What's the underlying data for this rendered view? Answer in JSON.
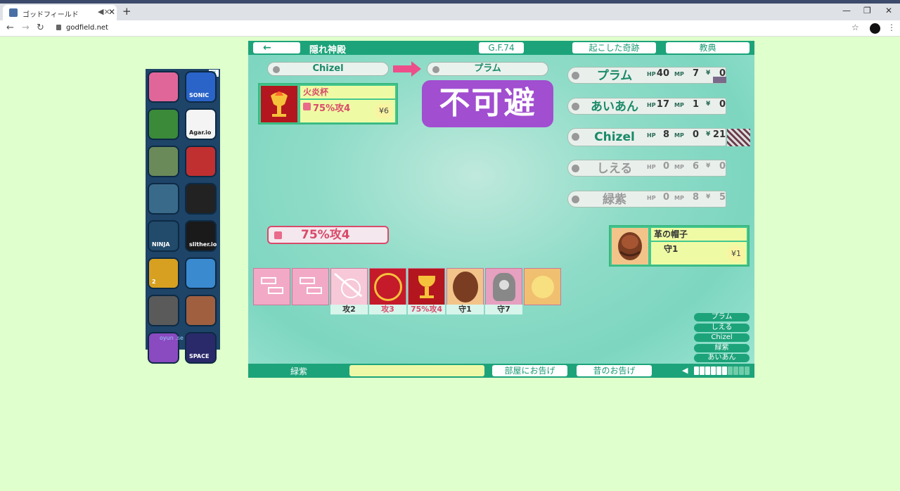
{
  "browser": {
    "tab_title": "ゴッドフィールド",
    "url": "godfield.net",
    "mute_icon": "speaker-mute-icon",
    "close_glyph": "✕",
    "newtab_glyph": "+",
    "min_glyph": "—",
    "max_glyph": "❐",
    "winclose_glyph": "✕"
  },
  "ad": {
    "apps": [
      "",
      "SONIC",
      "",
      "Agar.io",
      "",
      "",
      "",
      "",
      "NINJA",
      "slither.io",
      "2",
      "",
      "",
      "",
      "",
      "SPACE"
    ],
    "footer": "oyun .se",
    "badge": "i✕"
  },
  "game": {
    "back_glyph": "←",
    "stage_name": "隠れ神殿",
    "era": "G.F.74",
    "miracles_label": "起こした奇跡",
    "scripture_label": "教典",
    "attacker": "Chizel",
    "defender": "プラム",
    "active_card": {
      "name": "火炎杯",
      "effect": "75%攻4",
      "cost": "¥6"
    },
    "banner": "不可避",
    "effect_pill": "75%攻4",
    "players": [
      {
        "name": "プラム",
        "hp": "40",
        "mp": "7",
        "yen": "0",
        "alive": true
      },
      {
        "name": "あいあん",
        "hp": "17",
        "mp": "1",
        "yen": "0",
        "alive": true
      },
      {
        "name": "Chizel",
        "hp": "8",
        "mp": "0",
        "yen": "21",
        "alive": true
      },
      {
        "name": "しえる",
        "hp": "0",
        "mp": "6",
        "yen": "0",
        "alive": false
      },
      {
        "name": "緑紫",
        "hp": "0",
        "mp": "8",
        "yen": "5",
        "alive": false
      }
    ],
    "hp_label": "HP",
    "mp_label": "MP",
    "yen_label": "¥",
    "defense_card": {
      "name": "革の帽子",
      "effect": "守1",
      "cost": "¥1"
    },
    "hand_labels": [
      "",
      "",
      "攻2",
      "攻3",
      "75%攻4",
      "守1",
      "守7",
      ""
    ],
    "name_list": [
      "プラム",
      "しえる",
      "Chizel",
      "緑紫",
      "あいあん"
    ],
    "bottom_name": "緑紫",
    "room_notice": "部屋にお告げ",
    "past_notice": "昔のお告げ",
    "volume_glyph": "◀"
  },
  "colors": {
    "accent": "#1da37a",
    "banner": "#a14ed0",
    "attack": "#d94a6a"
  }
}
